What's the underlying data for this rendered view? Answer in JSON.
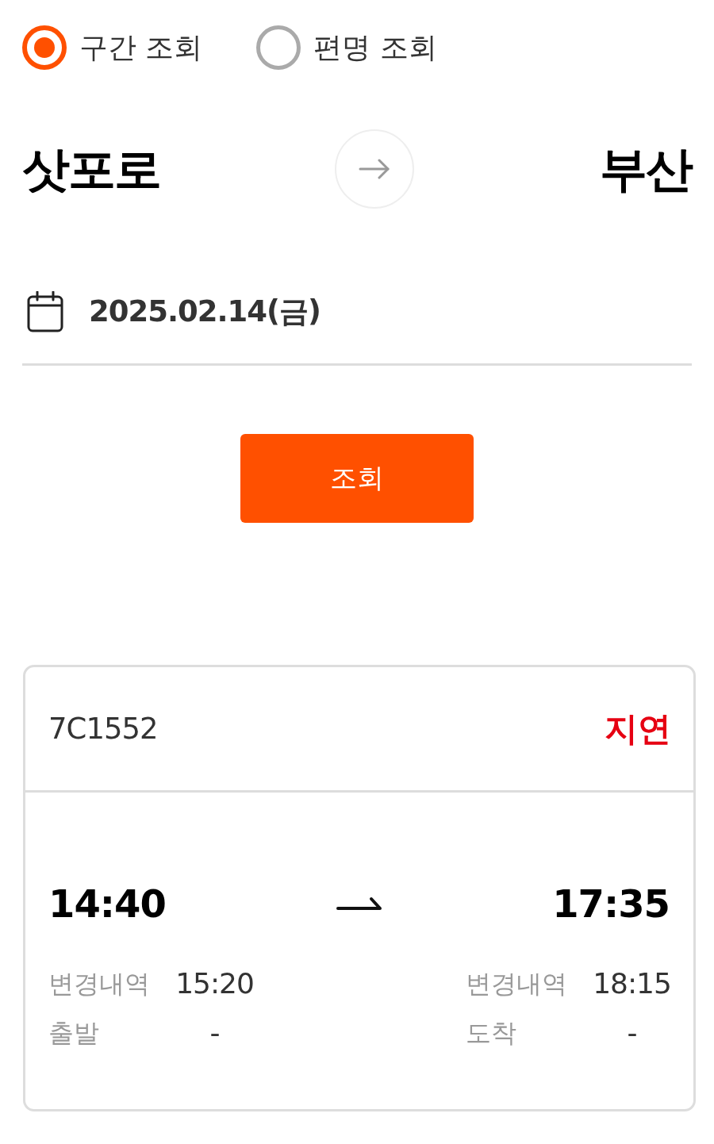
{
  "search_mode": [
    {
      "label": "구간 조회",
      "selected": true
    },
    {
      "label": "편명 조회",
      "selected": false
    }
  ],
  "route": {
    "origin": "삿포로",
    "destination": "부산"
  },
  "date": {
    "value": "2025.02.14(금)"
  },
  "search_button": {
    "label": "조회"
  },
  "flight": {
    "number": "7C1552",
    "status": "지연",
    "departure": {
      "time": "14:40",
      "details": [
        {
          "label": "변경내역",
          "value": "15:20"
        },
        {
          "label": "출발",
          "value": "-"
        }
      ]
    },
    "arrival": {
      "time": "17:35",
      "details": [
        {
          "label": "변경내역",
          "value": "18:15"
        },
        {
          "label": "도착",
          "value": "-"
        }
      ]
    }
  }
}
